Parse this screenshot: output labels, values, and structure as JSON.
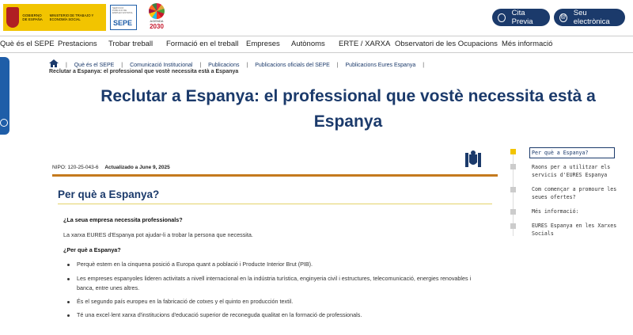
{
  "header": {
    "gov_logo_text": "GOBIERNO DE ESPAÑA",
    "ministry_text": "MINISTERIO DE TRABAJO Y ECONOMÍA SOCIAL",
    "sepe_logo": {
      "small": "SERVICIO PÚBLICO DE EMPLEO ESTATAL",
      "big": "SEPE"
    },
    "agenda_logo": {
      "label": "AGENDA",
      "year": "2030"
    },
    "cita_previa": "Cita Previa",
    "sede": "Seu electrònica"
  },
  "nav": {
    "items": [
      "Què és el SEPE",
      "Prestacions",
      "Trobar treball",
      "Formació en el treball",
      "Empreses",
      "Autònoms",
      "ERTE / XARXA",
      "Observatori de les Ocupacions",
      "Més informació"
    ]
  },
  "breadcrumb": {
    "items": [
      "Què és el SEPE",
      "Comunicació Institucional",
      "Publicacions",
      "Publicacions oficials del SEPE",
      "Publicacions Eures Espanya"
    ],
    "current": "Reclutar a Espanya: el professional que vostè necessita està a Espanya"
  },
  "page": {
    "title_line1": "Reclutar a Espanya: el professional que vostè necessita està a",
    "title_line2": "Espanya",
    "nipo": "NIPO: 120-25-043-6",
    "updated": "Actualizado a June 9, 2025"
  },
  "section": {
    "title": "Per què a Espanya?",
    "q1": "¿La seua empresa necessita professionals?",
    "p1": "La xarxa EURES d'Espanya pot ajudar-li a trobar la persona que necessita.",
    "q2": "¿Per què a Espanya?",
    "bullets": [
      "Perquè estem en la cinquena posició a Europa quant a població i Producte Interior Brut (PIB).",
      "Les empreses espanyoles lideren activitats a nivell internacional en la indústria turística, enginyeria civil i estructures, telecomunicació, energies renovables i banca, entre unes altres.",
      "És el segundo país europeu en la fabricació de cotxes y el quinto en producción textil.",
      "Té una excel·lent xarxa d'institucions d'educació superior de reconeguda qualitat en la formació de professionals."
    ]
  },
  "toc": {
    "items": [
      "Per què a Espanya?",
      "Raons per a utilitzar els servicis d'EURES Espanya",
      "Com començar a promoure les seues ofertes?",
      "Més informació:",
      "EURES Espanya en les Xarxes Socials"
    ]
  }
}
